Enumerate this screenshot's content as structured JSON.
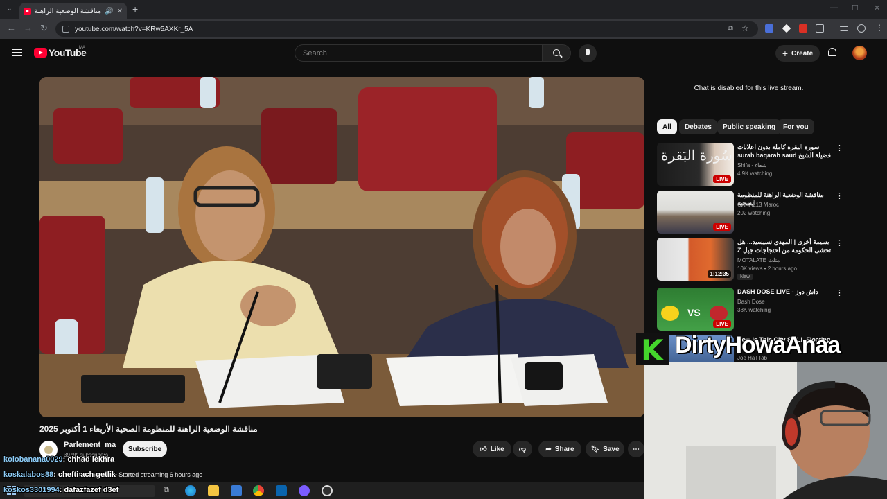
{
  "browser": {
    "tab_title": "مناقشة الوضعية الراهنة للمنظ",
    "url": "youtube.com/watch?v=KRw5AXKr_5A",
    "new_tab": "+",
    "minimize": "—",
    "maximize": "☐",
    "close": "✕"
  },
  "header": {
    "logo_text": "YouTube",
    "region": "MA",
    "search_placeholder": "Search",
    "create_label": "Create"
  },
  "video": {
    "title": "مناقشة الوضعية الراهنة للمنظومة الصحية الأربعاء 1 أكتوبر 2025",
    "channel": "Parlement_ma",
    "subscribers": "39.9K subscribers",
    "subscribe_label": "Subscribe",
    "like_label": "Like",
    "share_label": "Share",
    "save_label": "Save",
    "streamed": "1,628 views  Streamed live • Started streaming 6 hours ago"
  },
  "sidebar": {
    "chat_disabled": "Chat is disabled for this live stream.",
    "chips": [
      "All",
      "Debates",
      "Public speaking",
      "For you"
    ],
    "recs": [
      {
        "title": "سورة البقرة كاملة بدون اعلانات فضيلة الشيخ surah baqarah saud … سعود الشريم",
        "channel": "Shifa - شفاء",
        "meta": "4.9K watching",
        "badge": "LIVE"
      },
      {
        "title": "مناقشة الوضعية الراهنة للمنظومة الصحية",
        "channel": "CANAL13 Maroc",
        "meta": "202 watching",
        "badge": "LIVE"
      },
      {
        "title": "بسيمة أخرى | المهدي نسيسيد... هل تخشى الحكومة من احتجاجات جيل Z ؟",
        "channel": "MOTALATE مثلث",
        "meta": "10K views • 2 hours ago",
        "badge": "1:12:35",
        "new": "New"
      },
      {
        "title": "DASH DOSE LIVE - داش دوز",
        "channel": "Dash Dose",
        "meta": "38K watching",
        "badge": "LIVE"
      },
      {
        "title": "How Is This City STILL Floating",
        "channel": "Joe HaTTab",
        "meta": "",
        "badge": ""
      }
    ]
  },
  "overlay": {
    "streamer": "DirtyHowaAnaa",
    "chat": [
      {
        "user": "kolobanana0029",
        "msg": ": chhad lekhra"
      },
      {
        "user": "koskalabos88",
        "msg": ": chefti ach getlik"
      },
      {
        "user": "koskos3301994",
        "msg": ": dafazfazef d3ef"
      }
    ]
  },
  "colors": {
    "background": "#0f0f0f",
    "youtube_red": "#ff0033",
    "live_red": "#cc0000",
    "streamer_logo": "#44d62c"
  }
}
